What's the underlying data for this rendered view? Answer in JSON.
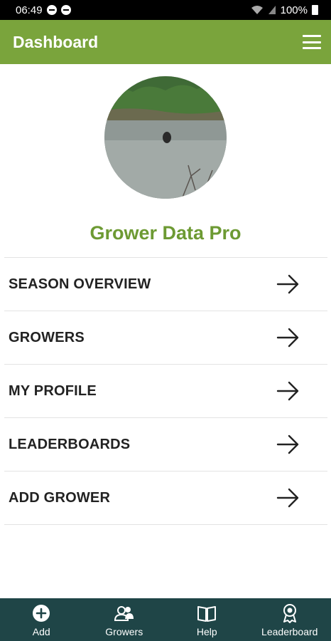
{
  "status_bar": {
    "time": "06:49",
    "battery": "100%"
  },
  "app_bar": {
    "title": "Dashboard"
  },
  "profile": {
    "app_name": "Grower Data Pro"
  },
  "menu": {
    "items": [
      {
        "label": "SEASON OVERVIEW"
      },
      {
        "label": "GROWERS"
      },
      {
        "label": "MY PROFILE"
      },
      {
        "label": "LEADERBOARDS"
      },
      {
        "label": "ADD GROWER"
      }
    ]
  },
  "bottom_nav": {
    "items": [
      {
        "label": "Add",
        "icon": "add-circle-icon"
      },
      {
        "label": "Growers",
        "icon": "people-icon"
      },
      {
        "label": "Help",
        "icon": "book-icon"
      },
      {
        "label": "Leaderboard",
        "icon": "award-icon"
      }
    ]
  },
  "colors": {
    "primary": "#7aa43c",
    "accent_text": "#6d9a33",
    "bottom_nav": "#1f4547"
  }
}
